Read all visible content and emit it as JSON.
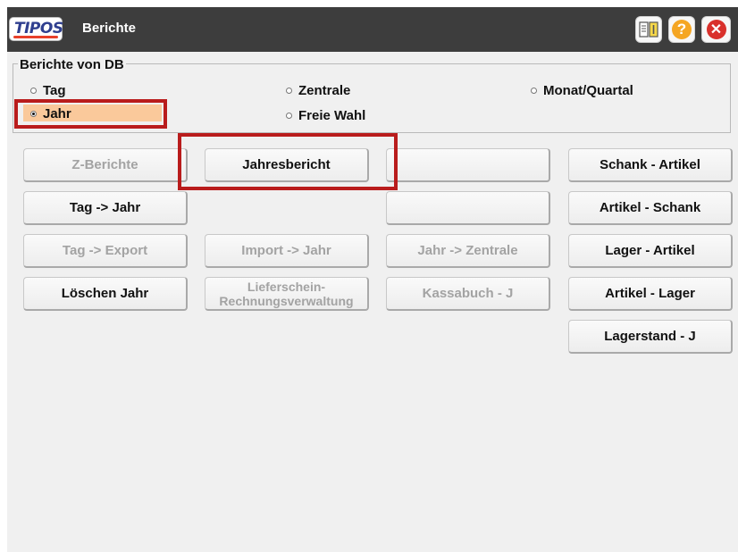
{
  "app": {
    "logo_text": "TIPOS",
    "title": "Berichte"
  },
  "toolbar": {
    "manual_icon": "manual-book-icon",
    "help_icon": "help-icon",
    "help_glyph": "?",
    "close_icon": "close-icon",
    "close_glyph": "✕"
  },
  "report_source": {
    "legend": "Berichte von DB",
    "options": [
      {
        "label": "Tag",
        "selected": false
      },
      {
        "label": "Zentrale",
        "selected": false
      },
      {
        "label": "Monat/Quartal",
        "selected": false
      },
      {
        "label": "Jahr",
        "selected": true
      },
      {
        "label": "Freie Wahl",
        "selected": false
      }
    ],
    "highlight_color": "#fac99b"
  },
  "buttons": {
    "z_berichte": {
      "label": "Z-Berichte",
      "enabled": false
    },
    "jahresbericht": {
      "label": "Jahresbericht",
      "enabled": true
    },
    "blank_1": {
      "label": "",
      "enabled": true
    },
    "schank_artikel": {
      "label": "Schank - Artikel",
      "enabled": true
    },
    "tag_jahr": {
      "label": "Tag -> Jahr",
      "enabled": true
    },
    "blank_2": {
      "label": "",
      "enabled": true
    },
    "artikel_schank": {
      "label": "Artikel - Schank",
      "enabled": true
    },
    "tag_export": {
      "label": "Tag -> Export",
      "enabled": false
    },
    "import_jahr": {
      "label": "Import -> Jahr",
      "enabled": false
    },
    "jahr_zentrale": {
      "label": "Jahr -> Zentrale",
      "enabled": false
    },
    "lager_artikel": {
      "label": "Lager - Artikel",
      "enabled": true
    },
    "loeschen_jahr": {
      "label": "Löschen Jahr",
      "enabled": true
    },
    "lieferschein_line1": "Lieferschein-",
    "lieferschein_line2": "Rechnungsverwaltung",
    "kassabuch": {
      "label": "Kassabuch - J",
      "enabled": false
    },
    "artikel_lager": {
      "label": "Artikel - Lager",
      "enabled": true
    },
    "lagerstand": {
      "label": "Lagerstand - J",
      "enabled": true
    }
  },
  "annotation_color": "#b91c1c"
}
